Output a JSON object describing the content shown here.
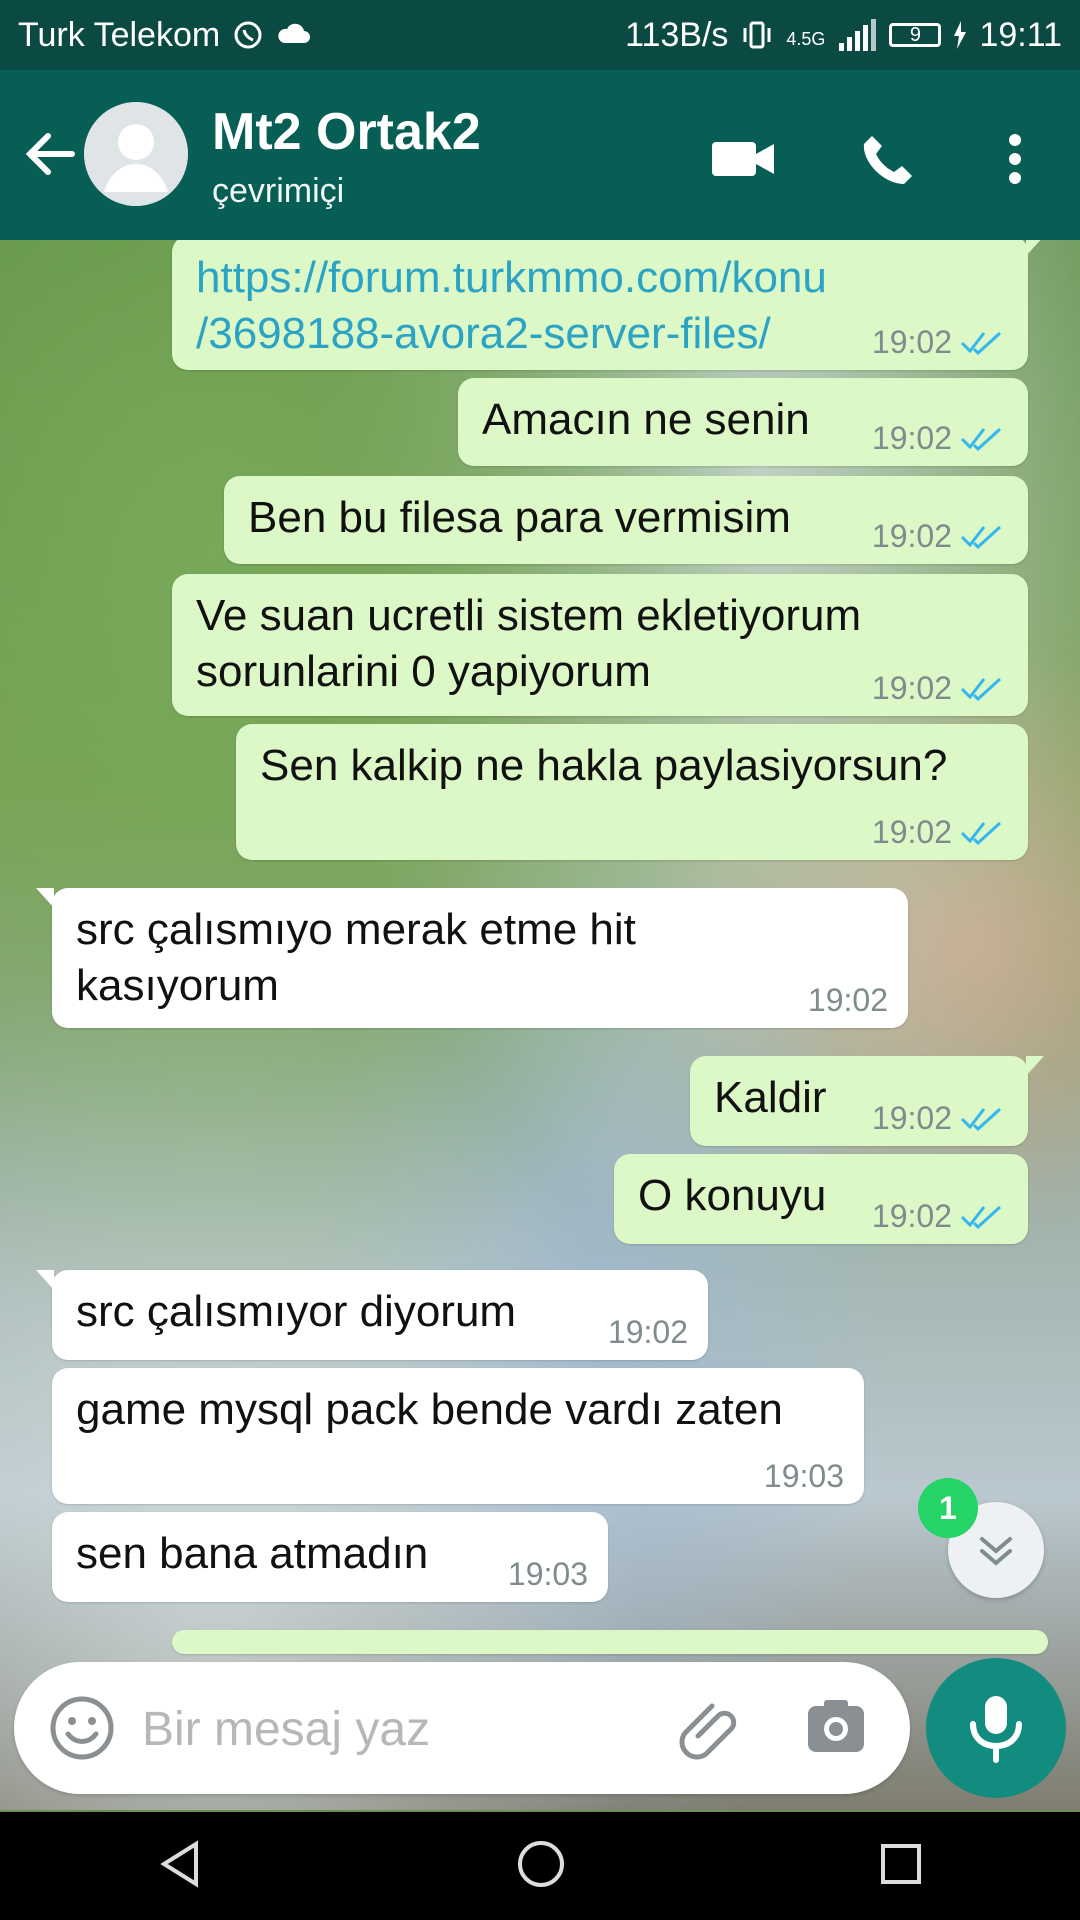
{
  "status_bar": {
    "carrier": "Turk Telekom",
    "speed": "113B/s",
    "network": "4.5G",
    "battery": "9",
    "time": "19:11"
  },
  "header": {
    "contact_name": "Mt2 Ortak2",
    "contact_status": "çevrimiçi"
  },
  "messages": [
    {
      "direction": "out",
      "text": "https://forum.turkmmo.com/konu\n/3698188-avora2-server-files/",
      "time": "19:02",
      "link": true
    },
    {
      "direction": "out",
      "text": "Amacın ne senin",
      "time": "19:02"
    },
    {
      "direction": "out",
      "text": "Ben bu filesa para vermisim",
      "time": "19:02"
    },
    {
      "direction": "out",
      "text": "Ve suan ucretli sistem ekletiyorum\nsorunlarini 0 yapiyorum",
      "time": "19:02"
    },
    {
      "direction": "out",
      "text": "Sen kalkip ne hakla paylasiyorsun?",
      "time": "19:02"
    },
    {
      "direction": "in",
      "text": "src çalısmıyo merak etme hit\nkasıyorum",
      "time": "19:02"
    },
    {
      "direction": "out",
      "text": "Kaldir",
      "time": "19:02"
    },
    {
      "direction": "out",
      "text": "O konuyu",
      "time": "19:02"
    },
    {
      "direction": "in",
      "text": "src çalısmıyor diyorum",
      "time": "19:02"
    },
    {
      "direction": "in",
      "text": "game mysql pack bende vardı zaten",
      "time": "19:03"
    },
    {
      "direction": "in",
      "text": "sen bana atmadın",
      "time": "19:03"
    }
  ],
  "scroll_button": {
    "badge": "1"
  },
  "composer": {
    "placeholder": "Bir mesaj yaz"
  },
  "colors": {
    "header": "#075e54",
    "outgoing_bubble": "#dcf8c6",
    "incoming_bubble": "#ffffff",
    "link": "#2aa3c4",
    "read_ticks": "#34b7f1",
    "mic_button": "#128c7e",
    "badge": "#25d366"
  },
  "icons": [
    "whatsapp-icon",
    "cloud-icon",
    "vibrate-icon",
    "signal-icon",
    "battery-icon",
    "back-arrow-icon",
    "avatar-icon",
    "video-call-icon",
    "phone-icon",
    "more-vert-icon",
    "double-check-icon",
    "double-chevron-down-icon",
    "emoji-icon",
    "paperclip-icon",
    "camera-icon",
    "mic-icon",
    "back-triangle-icon",
    "home-circle-icon",
    "recent-square-icon"
  ]
}
